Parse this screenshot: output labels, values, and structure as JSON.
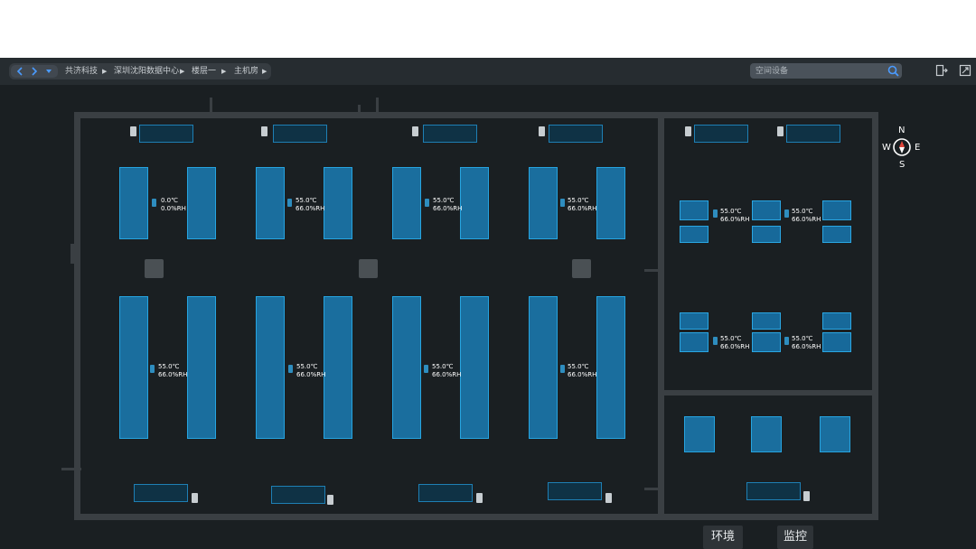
{
  "breadcrumbs": [
    "共济科技",
    "深圳沈阳数据中心",
    "楼层一",
    "主机房"
  ],
  "nav": {
    "back_icon": "chevron-left-icon",
    "forward_icon": "chevron-right-icon",
    "menu_icon": "caret-down-icon"
  },
  "search": {
    "placeholder": "空间设备"
  },
  "compass": {
    "north": "N",
    "south": "S",
    "east": "E",
    "west": "W"
  },
  "sensors": {
    "main_top": [
      {
        "temp": "0.0℃",
        "humidity": "0.0%RH"
      },
      {
        "temp": "55.0℃",
        "humidity": "66.0%RH"
      },
      {
        "temp": "55.0℃",
        "humidity": "66.0%RH"
      },
      {
        "temp": "55.0℃",
        "humidity": "66.0%RH"
      }
    ],
    "main_bottom": [
      {
        "temp": "55.0℃",
        "humidity": "66.0%RH"
      },
      {
        "temp": "55.0℃",
        "humidity": "66.0%RH"
      },
      {
        "temp": "55.0℃",
        "humidity": "66.0%RH"
      },
      {
        "temp": "55.0℃",
        "humidity": "66.0%RH"
      }
    ],
    "right_top": [
      {
        "temp": "55.0℃",
        "humidity": "66.0%RH"
      },
      {
        "temp": "55.0℃",
        "humidity": "66.0%RH"
      }
    ],
    "right_middle": [
      {
        "temp": "55.0℃",
        "humidity": "66.0%RH"
      },
      {
        "temp": "55.0℃",
        "humidity": "66.0%RH"
      }
    ]
  },
  "buttons": {
    "environment": "环境",
    "monitor": "监控"
  },
  "colors": {
    "background": "#1a1f22",
    "topbar": "#262c30",
    "wall": "#3a3f43",
    "rack": "#1a6e9e",
    "rack_border": "#26a4e0",
    "accent": "#4a9bff"
  }
}
